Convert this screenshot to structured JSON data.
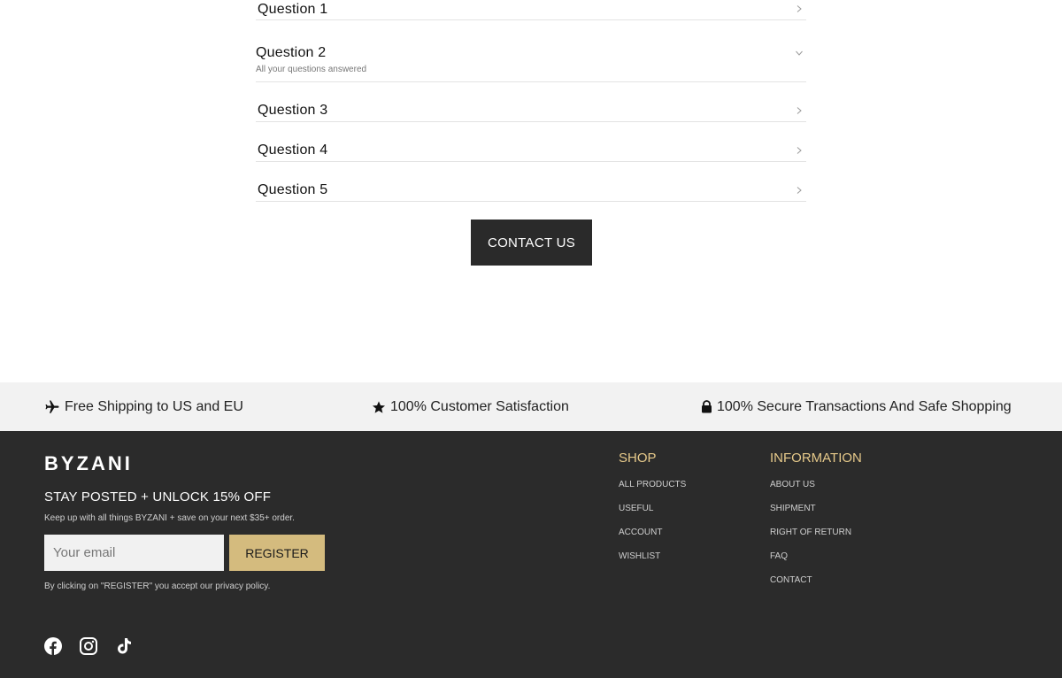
{
  "faq": {
    "items": [
      {
        "question": "Question 1"
      },
      {
        "question": "Question 2",
        "answer": "All your questions answered"
      },
      {
        "question": "Question 3"
      },
      {
        "question": "Question 4"
      },
      {
        "question": "Question 5"
      }
    ],
    "contact_label": "CONTACT US"
  },
  "trust": {
    "shipping": "Free Shipping to US and EU",
    "satisfaction": "100% Customer Satisfaction",
    "secure": "100% Secure Transactions And Safe Shopping"
  },
  "footer": {
    "logo": "BYZANI",
    "promo_title": "STAY POSTED + UNLOCK 15% OFF",
    "promo_sub": "Keep up with all things BYZANI + save on your next $35+ order.",
    "email_placeholder": "Your email",
    "register_label": "REGISTER",
    "policy": "By clicking on \"REGISTER\" you accept our privacy policy.",
    "shop": {
      "title": "SHOP",
      "links": [
        "ALL PRODUCTS",
        "USEFUL",
        "ACCOUNT",
        "WISHLIST"
      ]
    },
    "information": {
      "title": "INFORMATION",
      "links": [
        "ABOUT US",
        "SHIPMENT",
        "RIGHT OF RETURN",
        "FAQ",
        "CONTACT"
      ]
    },
    "socials": [
      "facebook-icon",
      "instagram-icon",
      "tiktok-icon"
    ]
  },
  "colors": {
    "footer_bg": "#2b2b2b",
    "accent_gold": "#d4bb7e",
    "heading_gold": "#e6c98a",
    "button_dark": "#2a2a2a"
  }
}
